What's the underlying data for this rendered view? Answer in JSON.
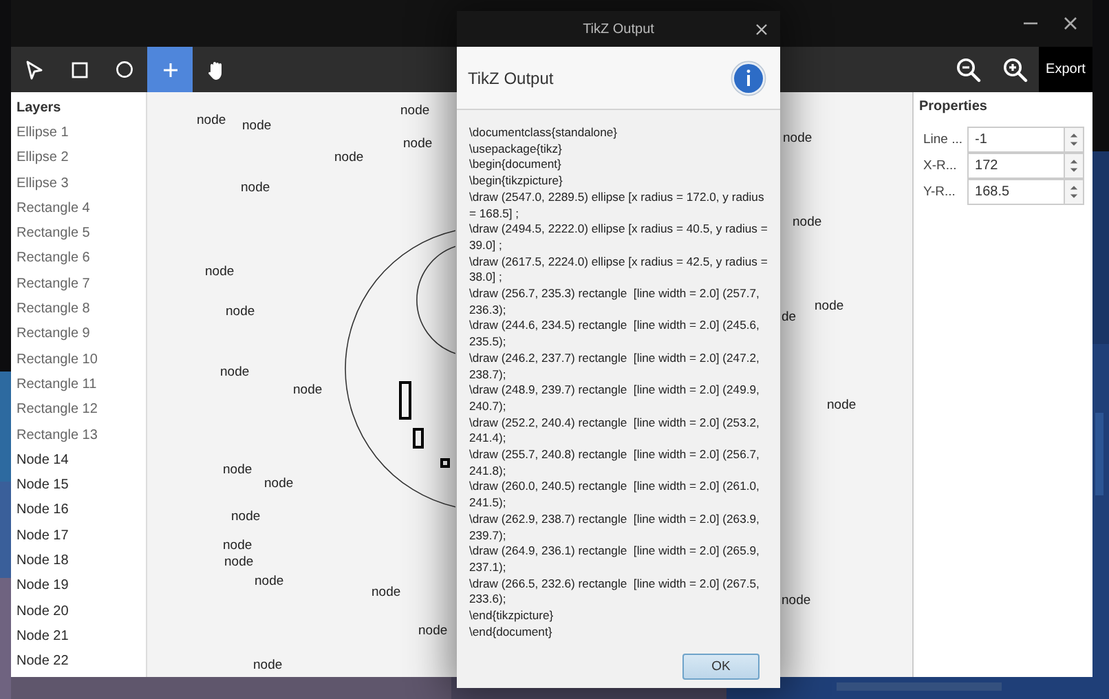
{
  "toolbar": {
    "tools": [
      {
        "kind": "pointer",
        "selected": false
      },
      {
        "kind": "rectangle",
        "selected": false
      },
      {
        "kind": "circle",
        "selected": false
      },
      {
        "kind": "add",
        "selected": true
      },
      {
        "kind": "hand",
        "selected": false
      }
    ],
    "zoom_buttons": [
      {
        "kind": "zoom-out"
      },
      {
        "kind": "zoom-in"
      }
    ],
    "export_label": "Export"
  },
  "layers": {
    "title": "Layers",
    "items": [
      {
        "label": "Ellipse 1",
        "kind": "shape"
      },
      {
        "label": "Ellipse 2",
        "kind": "shape"
      },
      {
        "label": "Ellipse 3",
        "kind": "shape"
      },
      {
        "label": "Rectangle 4",
        "kind": "shape"
      },
      {
        "label": "Rectangle 5",
        "kind": "shape"
      },
      {
        "label": "Rectangle 6",
        "kind": "shape"
      },
      {
        "label": "Rectangle 7",
        "kind": "shape"
      },
      {
        "label": "Rectangle 8",
        "kind": "shape"
      },
      {
        "label": "Rectangle 9",
        "kind": "shape"
      },
      {
        "label": "Rectangle 10",
        "kind": "shape"
      },
      {
        "label": "Rectangle 11",
        "kind": "shape"
      },
      {
        "label": "Rectangle 12",
        "kind": "shape"
      },
      {
        "label": "Rectangle 13",
        "kind": "shape"
      },
      {
        "label": "Node 14",
        "kind": "node"
      },
      {
        "label": "Node 15",
        "kind": "node"
      },
      {
        "label": "Node 16",
        "kind": "node"
      },
      {
        "label": "Node 17",
        "kind": "node"
      },
      {
        "label": "Node 18",
        "kind": "node"
      },
      {
        "label": "Node 19",
        "kind": "node"
      },
      {
        "label": "Node 20",
        "kind": "node"
      },
      {
        "label": "Node 21",
        "kind": "node"
      },
      {
        "label": "Node 22",
        "kind": "node"
      }
    ]
  },
  "canvas": {
    "node_labels": [
      "node",
      "node",
      "node",
      "node",
      "node",
      "node",
      "node",
      "node",
      "node",
      "node",
      "node",
      "node",
      "node",
      "node",
      "node",
      "node",
      "node",
      "node",
      "node",
      "node",
      "node",
      "node",
      "de",
      "node",
      "node"
    ]
  },
  "properties": {
    "title": "Properties",
    "fields": [
      {
        "label": "Line ...",
        "value": "-1"
      },
      {
        "label": "X-R...",
        "value": "172"
      },
      {
        "label": "Y-R...",
        "value": "168.5"
      }
    ]
  },
  "dialog": {
    "window_title": "TikZ Output",
    "heading": "TikZ Output",
    "code_lines": [
      "\\documentclass{standalone}",
      "\\usepackage{tikz}",
      "\\begin{document}",
      "\\begin{tikzpicture}",
      "\\draw (2547.0, 2289.5) ellipse [x radius = 172.0, y radius = 168.5] ;",
      "\\draw (2494.5, 2222.0) ellipse [x radius = 40.5, y radius = 39.0] ;",
      "\\draw (2617.5, 2224.0) ellipse [x radius = 42.5, y radius = 38.0] ;",
      "\\draw (256.7, 235.3) rectangle  [line width = 2.0] (257.7, 236.3);",
      "\\draw (244.6, 234.5) rectangle  [line width = 2.0] (245.6, 235.5);",
      "\\draw (246.2, 237.7) rectangle  [line width = 2.0] (247.2, 238.7);",
      "\\draw (248.9, 239.7) rectangle  [line width = 2.0] (249.9, 240.7);",
      "\\draw (252.2, 240.4) rectangle  [line width = 2.0] (253.2, 241.4);",
      "\\draw (255.7, 240.8) rectangle  [line width = 2.0] (256.7, 241.8);",
      "\\draw (260.0, 240.5) rectangle  [line width = 2.0] (261.0, 241.5);",
      "\\draw (262.9, 238.7) rectangle  [line width = 2.0] (263.9, 239.7);",
      "\\draw (264.9, 236.1) rectangle  [line width = 2.0] (265.9, 237.1);",
      "\\draw (266.5, 232.6) rectangle  [line width = 2.0] (267.5, 233.6);",
      "\\end{tikzpicture}",
      "\\end{document}"
    ],
    "ok_label": "OK"
  }
}
